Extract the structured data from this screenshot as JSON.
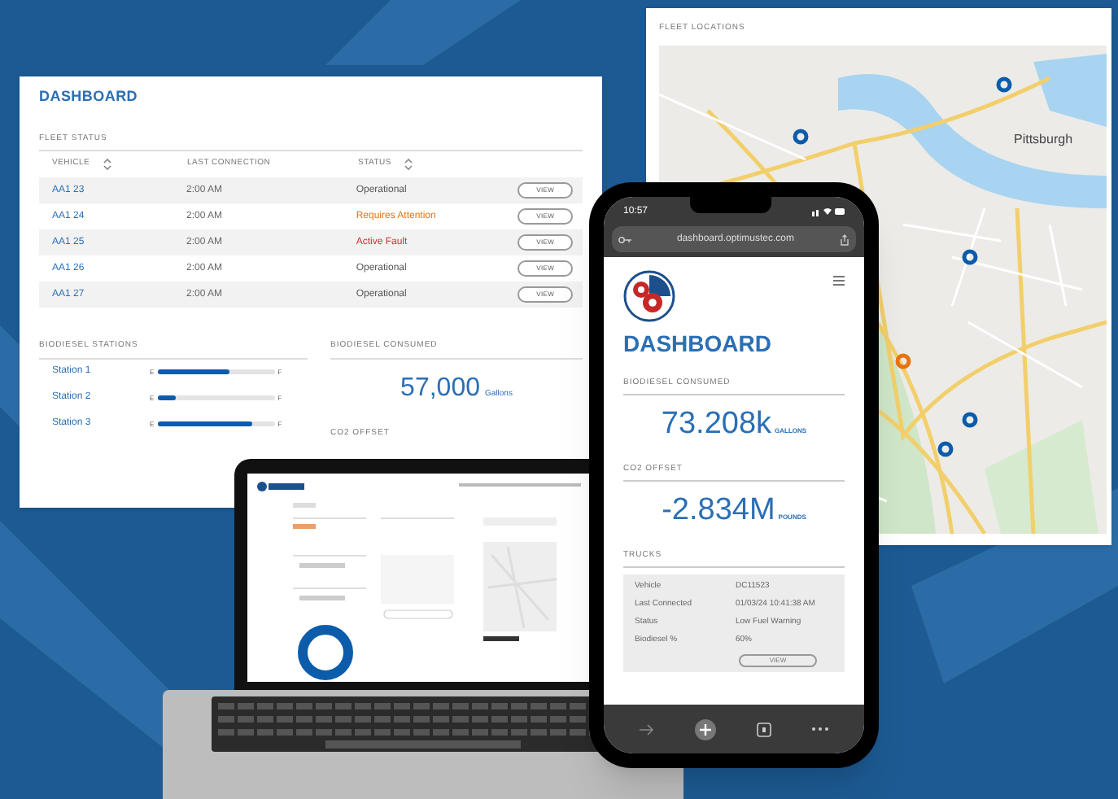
{
  "dashboard_panel": {
    "title": "DASHBOARD",
    "fleet_status": {
      "heading": "FLEET STATUS",
      "columns": [
        {
          "label": "VEHICLE",
          "sortable": true
        },
        {
          "label": "LAST CONNECTION",
          "sortable": false
        },
        {
          "label": "STATUS",
          "sortable": true
        }
      ],
      "rows": [
        {
          "vehicle": "AA1 23",
          "last_connection": "2:00 AM",
          "status": "Operational",
          "color": "#555555",
          "action": "VIEW"
        },
        {
          "vehicle": "AA1 24",
          "last_connection": "2:00 AM",
          "status": "Requires Attention",
          "color": "#e8730c",
          "action": "VIEW"
        },
        {
          "vehicle": "AA1 25",
          "last_connection": "2:00 AM",
          "status": "Active Fault",
          "color": "#d32f2f",
          "action": "VIEW"
        },
        {
          "vehicle": "AA1 26",
          "last_connection": "2:00 AM",
          "status": "Operational",
          "color": "#555555",
          "action": "VIEW"
        },
        {
          "vehicle": "AA1 27",
          "last_connection": "2:00 AM",
          "status": "Operational",
          "color": "#555555",
          "action": "VIEW"
        }
      ]
    },
    "stations": {
      "heading": "BIODIESEL STATIONS",
      "items": [
        {
          "name": "Station 1",
          "empty_mark": "E",
          "full_mark": "F",
          "level": 0.62
        },
        {
          "name": "Station 2",
          "empty_mark": "E",
          "full_mark": "F",
          "level": 0.16
        },
        {
          "name": "Station 3",
          "empty_mark": "E",
          "full_mark": "F",
          "level": 0.81
        }
      ]
    },
    "consumed": {
      "heading": "BIODIESEL CONSUMED",
      "value": "57,000",
      "unit": "Gallons"
    },
    "co2": {
      "heading": "CO2 OFFSET"
    }
  },
  "map_panel": {
    "title": "FLEET LOCATIONS",
    "city_label": "Pittsburgh",
    "pins": [
      {
        "color": "#0b5cab"
      },
      {
        "color": "#0b5cab"
      },
      {
        "color": "#0b5cab"
      },
      {
        "color": "#e8730c"
      },
      {
        "color": "#0b5cab"
      },
      {
        "color": "#0b5cab"
      }
    ]
  },
  "phone": {
    "time": "10:57",
    "url": "dashboard.optimustec.com",
    "title": "DASHBOARD",
    "consumed": {
      "heading": "BIODIESEL CONSUMED",
      "value": "73.208k",
      "unit": "GALLONS"
    },
    "co2": {
      "heading": "CO2 OFFSET",
      "value": "-2.834M",
      "unit": "POUNDS"
    },
    "trucks": {
      "heading": "TRUCKS",
      "fields": [
        {
          "label": "Vehicle",
          "value": "DC11523"
        },
        {
          "label": "Last Connected",
          "value": "01/03/24 10:41:38 AM"
        },
        {
          "label": "Status",
          "value": "Low Fuel Warning"
        },
        {
          "label": "Biodiesel %",
          "value": "60%"
        }
      ],
      "action": "VIEW"
    }
  }
}
